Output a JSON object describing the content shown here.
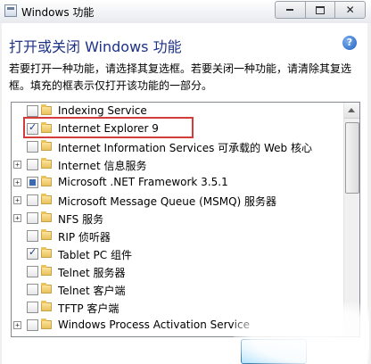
{
  "window": {
    "title": "Windows 功能"
  },
  "panel": {
    "heading": "打开或关闭 Windows 功能",
    "description": "若要打开一种功能，请选择其复选框。若要关闭一种功能，请清除其复选框。填充的框表示仅打开该功能的一部分。"
  },
  "features": [
    {
      "label": "Indexing Service",
      "state": "unchecked",
      "expandable": false
    },
    {
      "label": "Internet Explorer 9",
      "state": "checked",
      "expandable": false,
      "highlighted": true
    },
    {
      "label": "Internet Information Services 可承载的 Web 核心",
      "state": "unchecked",
      "expandable": false
    },
    {
      "label": "Internet 信息服务",
      "state": "unchecked",
      "expandable": true
    },
    {
      "label": "Microsoft .NET Framework 3.5.1",
      "state": "partial",
      "expandable": true
    },
    {
      "label": "Microsoft Message Queue (MSMQ) 服务器",
      "state": "unchecked",
      "expandable": true
    },
    {
      "label": "NFS 服务",
      "state": "unchecked",
      "expandable": true
    },
    {
      "label": "RIP 侦听器",
      "state": "unchecked",
      "expandable": false
    },
    {
      "label": "Tablet PC 组件",
      "state": "checked",
      "expandable": false
    },
    {
      "label": "Telnet 服务器",
      "state": "unchecked",
      "expandable": false
    },
    {
      "label": "Telnet 客户端",
      "state": "unchecked",
      "expandable": false
    },
    {
      "label": "TFTP 客户端",
      "state": "unchecked",
      "expandable": false
    },
    {
      "label": "Windows Process Activation Service",
      "state": "unchecked",
      "expandable": true
    }
  ],
  "icons": {
    "help": "help-icon",
    "folder": "folder-icon",
    "minimize": "minimize-icon",
    "maximize": "maximize-icon",
    "close": "close-icon"
  },
  "colors": {
    "heading": "#1e3287",
    "highlight": "#d43c3c"
  }
}
